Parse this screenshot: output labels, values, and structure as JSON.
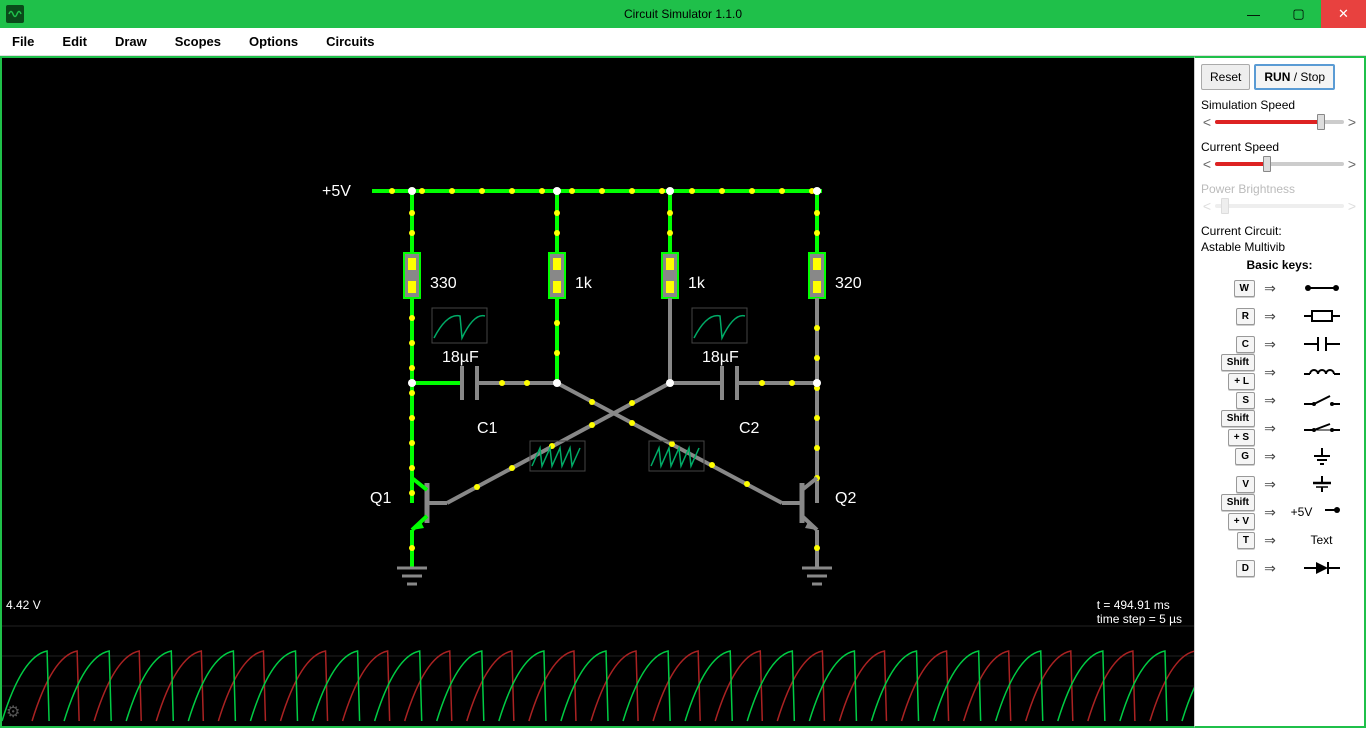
{
  "window": {
    "title": "Circuit Simulator 1.1.0"
  },
  "menu": {
    "file": "File",
    "edit": "Edit",
    "draw": "Draw",
    "scopes": "Scopes",
    "options": "Options",
    "circuits": "Circuits"
  },
  "sidebar": {
    "reset": "Reset",
    "run_stop": "RUN / Stop",
    "sliders": {
      "sim_speed": {
        "label": "Simulation Speed",
        "pos": 82
      },
      "cur_speed": {
        "label": "Current Speed",
        "pos": 40
      },
      "power_bright": {
        "label": "Power Brightness",
        "pos": 8
      }
    },
    "circuit_label": "Current Circuit:",
    "circuit_name": "Astable Multivib",
    "keys_title": "Basic keys:",
    "keys": [
      {
        "k": [
          "W"
        ],
        "sym": "wire"
      },
      {
        "k": [
          "R"
        ],
        "sym": "resistor"
      },
      {
        "k": [
          "C"
        ],
        "sym": "capacitor"
      },
      {
        "k": [
          "Shift",
          "+ L"
        ],
        "sym": "inductor"
      },
      {
        "k": [
          "S"
        ],
        "sym": "switch-open"
      },
      {
        "k": [
          "Shift",
          "+ S"
        ],
        "sym": "switch-closed"
      },
      {
        "k": [
          "G"
        ],
        "sym": "ground"
      },
      {
        "k": [
          "V"
        ],
        "sym": "voltage"
      },
      {
        "k": [
          "Shift",
          "+ V"
        ],
        "sym": "vplus",
        "text": "+5V"
      },
      {
        "k": [
          "T"
        ],
        "sym": "text",
        "text": "Text"
      },
      {
        "k": [
          "D"
        ],
        "sym": "diode"
      }
    ]
  },
  "circuit": {
    "vlabel": "+5V",
    "r1": "330",
    "r2": "1k",
    "r3": "1k",
    "r4": "320",
    "c1_val": "18µF",
    "c2_val": "18µF",
    "c1_name": "C1",
    "c2_name": "C2",
    "q1": "Q1",
    "q2": "Q2"
  },
  "scope": {
    "voltage": "4.42 V",
    "time": "t = 494.91 ms",
    "step": "time step = 5 µs"
  }
}
